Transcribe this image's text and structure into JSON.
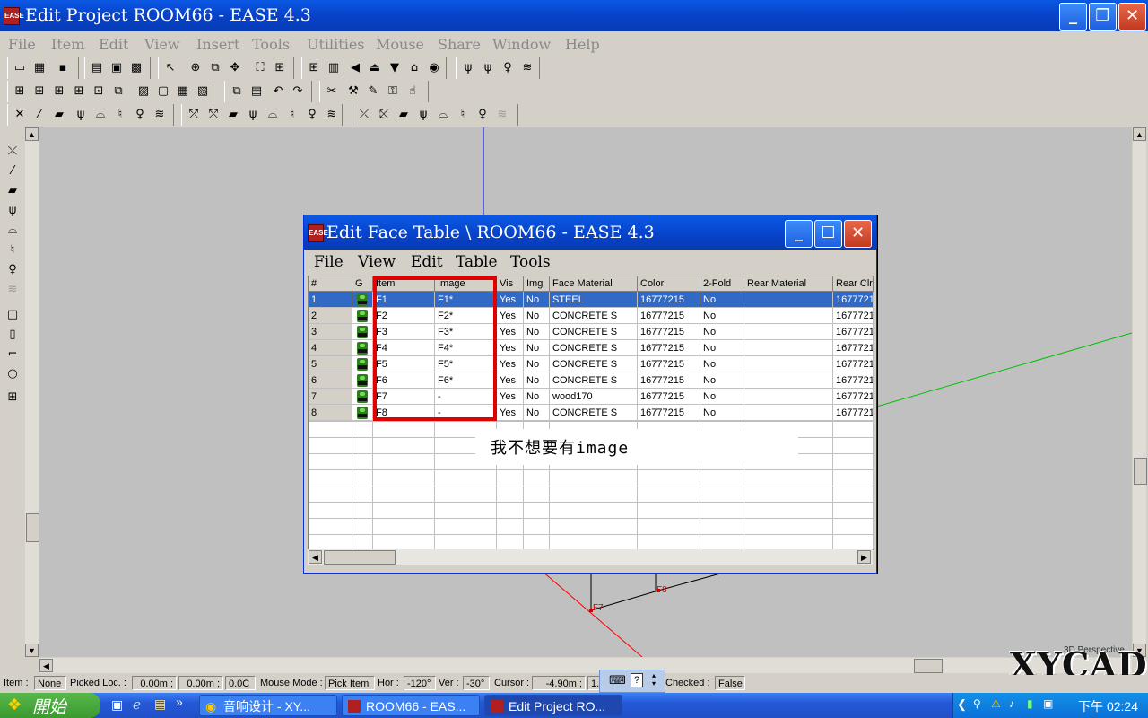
{
  "window": {
    "title": "Edit Project ROOM66 - EASE 4.3",
    "icon": "ease-app-icon"
  },
  "menu": [
    "File",
    "Item",
    "Edit",
    "View",
    "Insert",
    "Tools",
    "Utilities",
    "Mouse",
    "Share",
    "Window",
    "Help"
  ],
  "dialog": {
    "title": "Edit Face Table \\ ROOM66 - EASE 4.3",
    "menu": [
      "File",
      "View",
      "Edit",
      "Table",
      "Tools"
    ],
    "columns": [
      "#",
      "G",
      "Item",
      "Image",
      "Vis",
      "Img",
      "Face Material",
      "Color",
      "2-Fold",
      "Rear Material",
      "Rear Clr"
    ],
    "rows": [
      {
        "n": "1",
        "item": "F1",
        "image": "F1*",
        "vis": "Yes",
        "img": "No",
        "mat": "STEEL",
        "color": "16777215",
        "fold": "No",
        "rmat": "",
        "rclr": "1677721"
      },
      {
        "n": "2",
        "item": "F2",
        "image": "F2*",
        "vis": "Yes",
        "img": "No",
        "mat": "CONCRETE S",
        "color": "16777215",
        "fold": "No",
        "rmat": "",
        "rclr": "1677721"
      },
      {
        "n": "3",
        "item": "F3",
        "image": "F3*",
        "vis": "Yes",
        "img": "No",
        "mat": "CONCRETE S",
        "color": "16777215",
        "fold": "No",
        "rmat": "",
        "rclr": "1677721"
      },
      {
        "n": "4",
        "item": "F4",
        "image": "F4*",
        "vis": "Yes",
        "img": "No",
        "mat": "CONCRETE S",
        "color": "16777215",
        "fold": "No",
        "rmat": "",
        "rclr": "1677721"
      },
      {
        "n": "5",
        "item": "F5",
        "image": "F5*",
        "vis": "Yes",
        "img": "No",
        "mat": "CONCRETE S",
        "color": "16777215",
        "fold": "No",
        "rmat": "",
        "rclr": "1677721"
      },
      {
        "n": "6",
        "item": "F6",
        "image": "F6*",
        "vis": "Yes",
        "img": "No",
        "mat": "CONCRETE S",
        "color": "16777215",
        "fold": "No",
        "rmat": "",
        "rclr": "1677721"
      },
      {
        "n": "7",
        "item": "F7",
        "image": "-",
        "vis": "Yes",
        "img": "No",
        "mat": "wood170",
        "color": "16777215",
        "fold": "No",
        "rmat": "",
        "rclr": "1677721"
      },
      {
        "n": "8",
        "item": "F8",
        "image": "-",
        "vis": "Yes",
        "img": "No",
        "mat": "CONCRETE S",
        "color": "16777215",
        "fold": "No",
        "rmat": "",
        "rclr": "1677721"
      }
    ],
    "annotation": "我不想要有image"
  },
  "canvas": {
    "labels": [
      "F7",
      "F8"
    ],
    "view_label": "3D Perspective"
  },
  "status": {
    "item_label": "Item :",
    "item_value": "None",
    "picked_label": "Picked Loc. :",
    "picked_x": "0.00m ;",
    "picked_y": "0.00m ;",
    "picked_z": "0.0C",
    "mode_label": "Mouse Mode :",
    "mode_value": "Pick Item",
    "hor_label": "Hor :",
    "hor_value": "-120°",
    "ver_label": "Ver :",
    "ver_value": "-30°",
    "cursor_label": "Cursor :",
    "cursor_value": "-4.90m ;",
    "cursor_extra": "1.",
    "checked_label": "Checked :",
    "checked_value": "False"
  },
  "taskbar": {
    "start": "開始",
    "tasks": [
      "音响设计 - XY...",
      "ROOM66 - EAS...",
      "Edit Project RO..."
    ],
    "clock": "下午 02:24"
  },
  "watermark": "XYCAD",
  "colors": {
    "title_blue": "#0842c8",
    "highlight_red": "#e00000",
    "selection": "#3169c6"
  }
}
